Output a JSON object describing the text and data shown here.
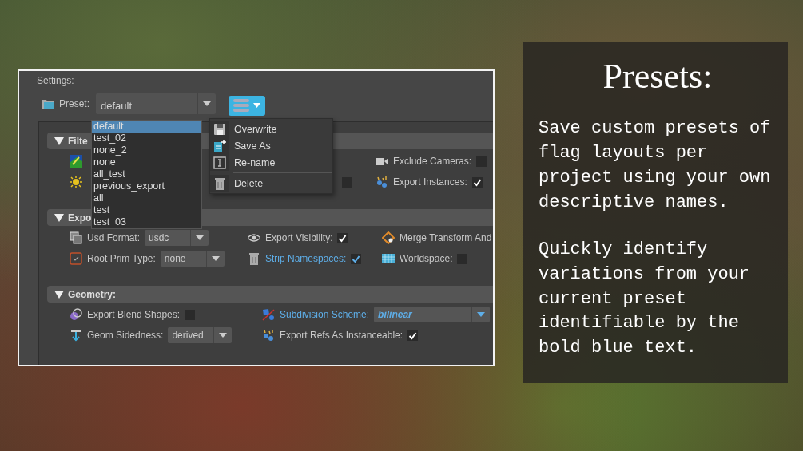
{
  "settings": {
    "title": "Settings:",
    "preset": {
      "label": "Preset:",
      "value": "default",
      "options": [
        {
          "label": "default",
          "selected": true
        },
        {
          "label": "test_02",
          "selected": false
        },
        {
          "label": "none_2",
          "selected": false
        },
        {
          "label": "none",
          "selected": false
        },
        {
          "label": "all_test",
          "selected": false
        },
        {
          "label": "previous_export",
          "selected": false
        },
        {
          "label": "all",
          "selected": false
        },
        {
          "label": "test",
          "selected": false
        },
        {
          "label": "test_03",
          "selected": false
        }
      ],
      "menu": [
        {
          "label": "Overwrite",
          "separator_before": false
        },
        {
          "label": "Save As",
          "separator_before": false
        },
        {
          "label": "Re-name",
          "separator_before": false
        },
        {
          "label": "Delete",
          "separator_before": true
        }
      ]
    }
  },
  "sections": [
    {
      "title": "Filte",
      "expanded": true,
      "rows": [
        [
          {
            "kind": "icon"
          },
          {
            "kind": "checkbox",
            "label": "Exclude Cameras:",
            "modified": false,
            "checked": false
          }
        ],
        [
          {
            "kind": "icon"
          },
          {
            "kind": "checkbox",
            "checked": false
          },
          {
            "kind": "checkbox",
            "label": "Export Instances:",
            "modified": false,
            "checked": true
          }
        ]
      ]
    },
    {
      "title": "Expo",
      "expanded": true,
      "rows": [
        [
          {
            "kind": "combo",
            "label": "Usd Format:",
            "modified": false,
            "value": "usdc"
          },
          {
            "kind": "checkbox",
            "label": "Export Visibility:",
            "modified": false,
            "checked": true
          },
          {
            "kind": "text",
            "label": "Merge Transform And",
            "modified": false
          }
        ],
        [
          {
            "kind": "combo",
            "label": "Root Prim Type:",
            "modified": false,
            "value": "none"
          },
          {
            "kind": "checkbox",
            "label": "Strip Namespaces:",
            "modified": true,
            "checked": true
          },
          {
            "kind": "checkbox",
            "label": "Worldspace:",
            "modified": false,
            "checked": false
          }
        ]
      ]
    },
    {
      "title": "Geometry:",
      "expanded": true,
      "rows": [
        [
          {
            "kind": "checkbox",
            "label": "Export Blend Shapes:",
            "modified": false,
            "checked": false
          },
          {
            "kind": "combo",
            "label": "Subdivision Scheme:",
            "modified": true,
            "value": "bilinear"
          }
        ],
        [
          {
            "kind": "combo",
            "label": "Geom Sidedness:",
            "modified": false,
            "value": "derived"
          },
          {
            "kind": "checkbox",
            "label": "Export Refs As Instanceable:",
            "modified": false,
            "checked": true
          }
        ]
      ]
    }
  ],
  "info": {
    "title": "Presets:",
    "paragraphs": [
      "Save custom presets of flag layouts per project using your own descriptive names.",
      "Quickly identify variations from your current preset identifiable by the bold blue text."
    ]
  }
}
